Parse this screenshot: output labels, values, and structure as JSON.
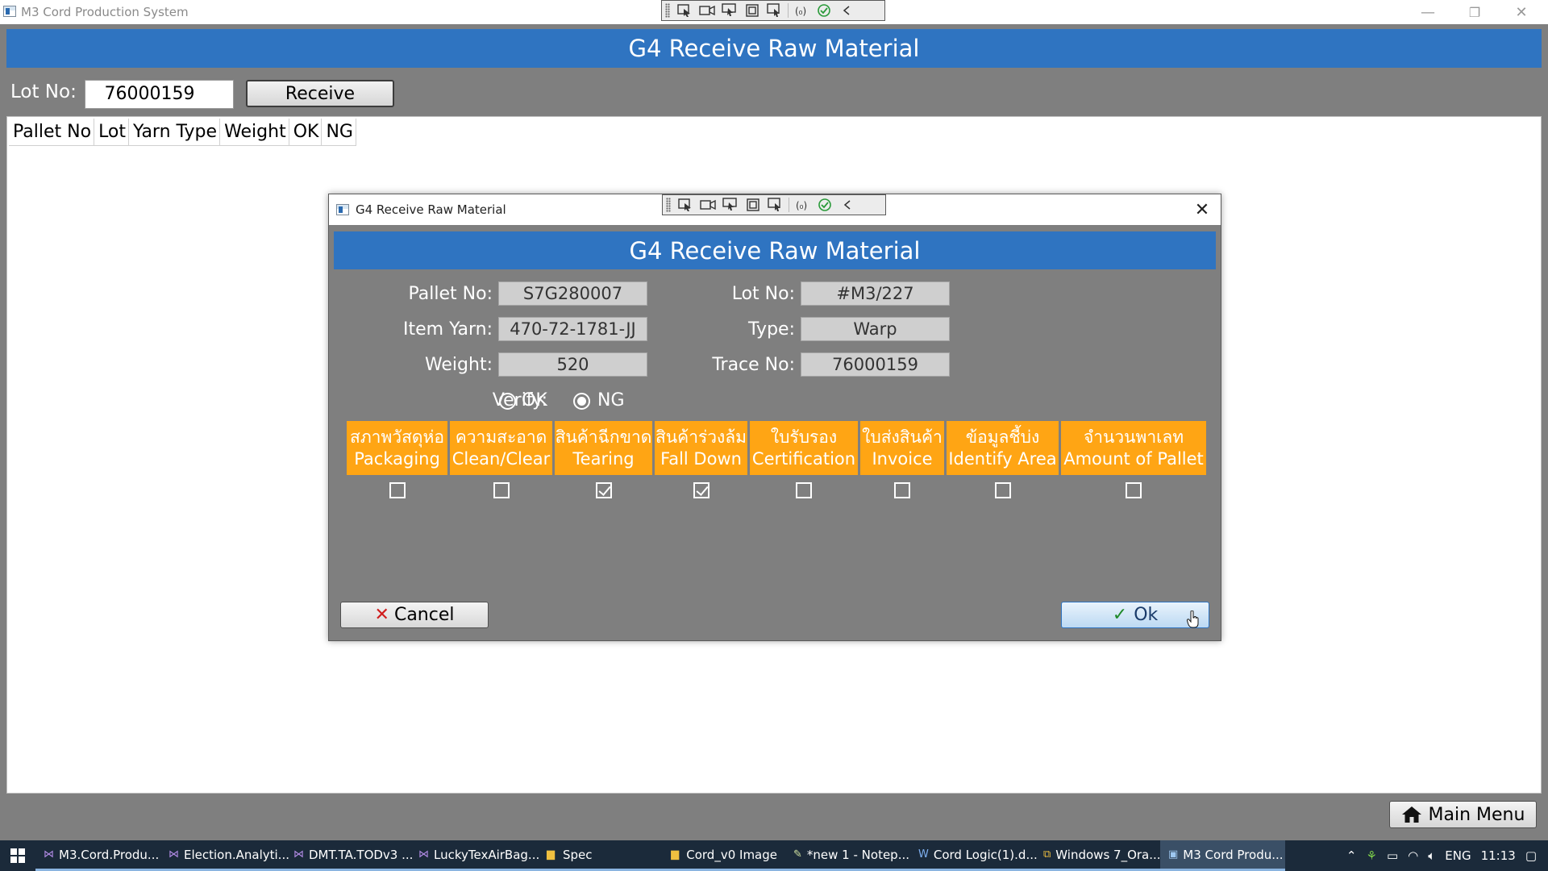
{
  "window": {
    "title": "M3 Cord Production System",
    "minimize": "—",
    "restore": "❐",
    "close": "✕"
  },
  "main": {
    "header": "G4 Receive Raw Material",
    "lot_label": "Lot No:",
    "lot_value": "76000159",
    "receive_label": "Receive",
    "grid_columns": [
      "Pallet No",
      "Lot",
      "Yarn Type",
      "Weight",
      "OK",
      "NG"
    ],
    "main_menu_label": "Main Menu"
  },
  "dialog": {
    "title": "G4 Receive Raw Material",
    "close": "✕",
    "header": "G4 Receive Raw Material",
    "fields": {
      "pallet_no_label": "Pallet No:",
      "pallet_no_value": "S7G280007",
      "item_yarn_label": "Item Yarn:",
      "item_yarn_value": "470-72-1781-JJ",
      "weight_label": "Weight:",
      "weight_value": "520",
      "lot_no_label": "Lot No:",
      "lot_no_value": "#M3/227",
      "type_label": "Type:",
      "type_value": "Warp",
      "trace_no_label": "Trace No:",
      "trace_no_value": "76000159"
    },
    "verify": {
      "label": "Verify:",
      "ok_label": "OK",
      "ng_label": "NG",
      "selected": "NG"
    },
    "checks": [
      {
        "thai": "สภาพวัสดุห่อ",
        "en": "Packaging",
        "checked": false
      },
      {
        "thai": "ความสะอาด",
        "en": "Clean/Clear",
        "checked": false
      },
      {
        "thai": "สินค้าฉีกขาด",
        "en": "Tearing",
        "checked": true
      },
      {
        "thai": "สินค้าร่วงล้ม",
        "en": "Fall Down",
        "checked": true
      },
      {
        "thai": "ใบรับรอง",
        "en": "Certification",
        "checked": false
      },
      {
        "thai": "ใบส่งสินค้า",
        "en": "Invoice",
        "checked": false
      },
      {
        "thai": "ข้อมูลชี้บ่ง",
        "en": "Identify Area",
        "checked": false
      },
      {
        "thai": "จำนวนพาเลท",
        "en": "Amount of Pallet",
        "checked": false
      }
    ],
    "cancel_label": "Cancel",
    "ok_label": "Ok"
  },
  "taskbar": {
    "items": [
      {
        "label": "M3.Cord.Produ...",
        "icon": "visual-studio-icon"
      },
      {
        "label": "Election.Analyti...",
        "icon": "visual-studio-icon"
      },
      {
        "label": "DMT.TA.TODv3 ...",
        "icon": "visual-studio-icon"
      },
      {
        "label": "LuckyTexAirBag...",
        "icon": "visual-studio-icon"
      },
      {
        "label": "Spec",
        "icon": "folder-icon"
      },
      {
        "label": "Cord_v0 Image",
        "icon": "folder-icon"
      },
      {
        "label": "*new 1 - Notep...",
        "icon": "notepad-icon"
      },
      {
        "label": "Cord Logic(1).d...",
        "icon": "word-icon"
      },
      {
        "label": "Windows 7_Ora...",
        "icon": "vm-icon"
      },
      {
        "label": "M3 Cord Produ...",
        "icon": "app-icon"
      }
    ],
    "tray_lang": "ENG",
    "clock": "11:13"
  },
  "colors": {
    "header_blue": "#2f74c1",
    "check_orange": "#ffa514",
    "background_gray": "#7f7f7f"
  }
}
